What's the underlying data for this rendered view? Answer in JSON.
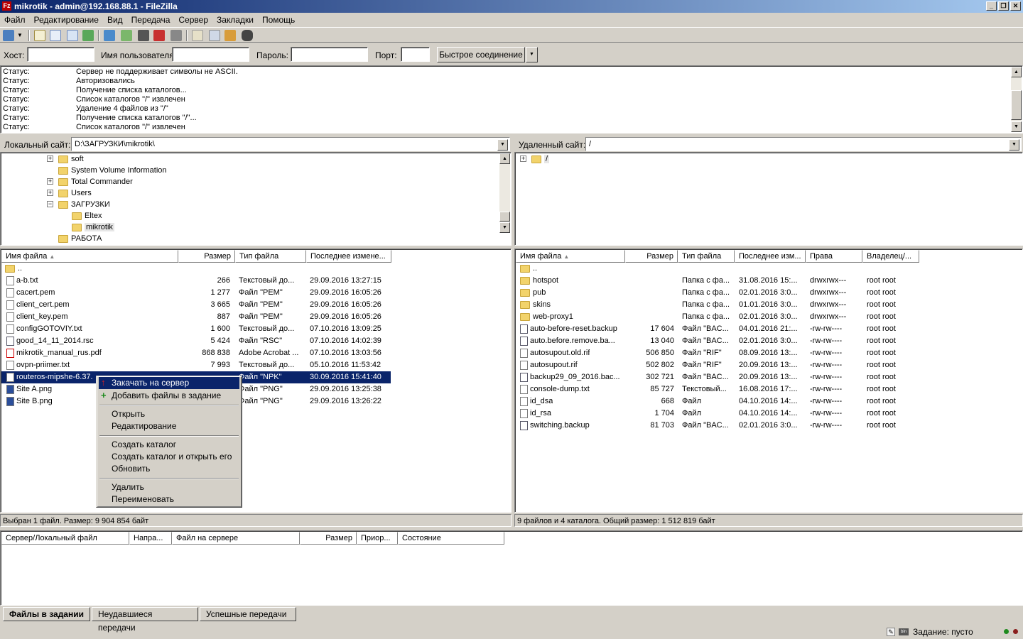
{
  "window": {
    "title": "mikrotik - admin@192.168.88.1 - FileZilla",
    "app_icon": "Fz"
  },
  "menu": [
    "Файл",
    "Редактирование",
    "Вид",
    "Передача",
    "Сервер",
    "Закладки",
    "Помощь"
  ],
  "quickconnect": {
    "host_label": "Хост:",
    "host_value": "",
    "user_label": "Имя пользователя",
    "user_value": "",
    "pass_label": "Пароль:",
    "pass_value": "",
    "port_label": "Порт:",
    "port_value": "",
    "connect_label": "Быстрое соединение"
  },
  "log": [
    {
      "label": "Статус:",
      "text": "Сервер не поддерживает символы не ASCII."
    },
    {
      "label": "Статус:",
      "text": "Авторизовались"
    },
    {
      "label": "Статус:",
      "text": "Получение списка каталогов..."
    },
    {
      "label": "Статус:",
      "text": "Список каталогов \"/\" извлечен"
    },
    {
      "label": "Статус:",
      "text": "Удаление 4 файлов из \"/\""
    },
    {
      "label": "Статус:",
      "text": "Получение списка каталогов \"/\"..."
    },
    {
      "label": "Статус:",
      "text": "Список каталогов \"/\" извлечен"
    }
  ],
  "local": {
    "site_label": "Локальный сайт:",
    "path": "D:\\ЗАГРУЗКИ\\mikrotik\\",
    "tree": [
      {
        "name": "soft",
        "expander": "+"
      },
      {
        "name": "System Volume Information",
        "expander": ""
      },
      {
        "name": "Total Commander",
        "expander": "+"
      },
      {
        "name": "Users",
        "expander": "+"
      },
      {
        "name": "ЗАГРУЗКИ",
        "expander": "−"
      },
      {
        "name": "Eltex",
        "expander": ""
      },
      {
        "name": "mikrotik",
        "expander": ""
      },
      {
        "name": "РАБОТА",
        "expander": ""
      }
    ],
    "columns": [
      "Имя файла",
      "Размер",
      "Тип файла",
      "Последнее измене..."
    ],
    "files": [
      {
        "name": "..",
        "size": "",
        "type": "",
        "modified": "",
        "icon": "folder"
      },
      {
        "name": "a-b.txt",
        "size": "266",
        "type": "Текстовый до...",
        "modified": "29.09.2016 13:27:15",
        "icon": "file"
      },
      {
        "name": "cacert.pem",
        "size": "1 277",
        "type": "Файл \"PEM\"",
        "modified": "29.09.2016 16:05:26",
        "icon": "file"
      },
      {
        "name": "client_cert.pem",
        "size": "3 665",
        "type": "Файл \"PEM\"",
        "modified": "29.09.2016 16:05:26",
        "icon": "file"
      },
      {
        "name": "client_key.pem",
        "size": "887",
        "type": "Файл \"PEM\"",
        "modified": "29.09.2016 16:05:26",
        "icon": "file"
      },
      {
        "name": "configGOTOVIY.txt",
        "size": "1 600",
        "type": "Текстовый до...",
        "modified": "07.10.2016 13:09:25",
        "icon": "file"
      },
      {
        "name": "good_14_11_2014.rsc",
        "size": "5 424",
        "type": "Файл \"RSC\"",
        "modified": "07.10.2016 14:02:39",
        "icon": "rsc"
      },
      {
        "name": "mikrotik_manual_rus.pdf",
        "size": "868 838",
        "type": "Adobe Acrobat ...",
        "modified": "07.10.2016 13:03:56",
        "icon": "pdf"
      },
      {
        "name": "ovpn-priimer.txt",
        "size": "7 993",
        "type": "Текстовый до...",
        "modified": "05.10.2016 11:53:42",
        "icon": "file"
      },
      {
        "name": "routeros-mipshe-6.37.",
        "size": "",
        "type": "Файл \"NPK\"",
        "modified": "30.09.2016 15:41:40",
        "icon": "file",
        "selected": true
      },
      {
        "name": "Site A.png",
        "size": "",
        "type": "Файл \"PNG\"",
        "modified": "29.09.2016 13:25:38",
        "icon": "png"
      },
      {
        "name": "Site B.png",
        "size": "",
        "type": "Файл \"PNG\"",
        "modified": "29.09.2016 13:26:22",
        "icon": "png"
      }
    ],
    "status": "Выбран 1 файл. Размер: 9 904 854 байт"
  },
  "remote": {
    "site_label": "Удаленный сайт:",
    "path": "/",
    "tree_root": "/",
    "columns": [
      "Имя файла",
      "Размер",
      "Тип файла",
      "Последнее изм...",
      "Права",
      "Владелец/..."
    ],
    "files": [
      {
        "name": "..",
        "size": "",
        "type": "",
        "modified": "",
        "perms": "",
        "owner": "",
        "icon": "folder"
      },
      {
        "name": "hotspot",
        "size": "",
        "type": "Папка с фа...",
        "modified": "31.08.2016 15:...",
        "perms": "drwxrwx---",
        "owner": "root root",
        "icon": "folder"
      },
      {
        "name": "pub",
        "size": "",
        "type": "Папка с фа...",
        "modified": "02.01.2016 3:0...",
        "perms": "drwxrwx---",
        "owner": "root root",
        "icon": "folder"
      },
      {
        "name": "skins",
        "size": "",
        "type": "Папка с фа...",
        "modified": "01.01.2016 3:0...",
        "perms": "drwxrwx---",
        "owner": "root root",
        "icon": "folder"
      },
      {
        "name": "web-proxy1",
        "size": "",
        "type": "Папка с фа...",
        "modified": "02.01.2016 3:0...",
        "perms": "drwxrwx---",
        "owner": "root root",
        "icon": "folder"
      },
      {
        "name": "auto-before-reset.backup",
        "size": "17 604",
        "type": "Файл \"BAC...",
        "modified": "04.01.2016 21:...",
        "perms": "-rw-rw----",
        "owner": "root root",
        "icon": "rsc"
      },
      {
        "name": "auto.before.remove.ba...",
        "size": "13 040",
        "type": "Файл \"BAC...",
        "modified": "02.01.2016 3:0...",
        "perms": "-rw-rw----",
        "owner": "root root",
        "icon": "rsc"
      },
      {
        "name": "autosupout.old.rif",
        "size": "506 850",
        "type": "Файл \"RIF\"",
        "modified": "08.09.2016 13:...",
        "perms": "-rw-rw----",
        "owner": "root root",
        "icon": "file"
      },
      {
        "name": "autosupout.rif",
        "size": "502 802",
        "type": "Файл \"RIF\"",
        "modified": "20.09.2016 13:...",
        "perms": "-rw-rw----",
        "owner": "root root",
        "icon": "file"
      },
      {
        "name": "backup29_09_2016.bac...",
        "size": "302 721",
        "type": "Файл \"BAC...",
        "modified": "20.09.2016 13:...",
        "perms": "-rw-rw----",
        "owner": "root root",
        "icon": "rsc"
      },
      {
        "name": "console-dump.txt",
        "size": "85 727",
        "type": "Текстовый...",
        "modified": "16.08.2016 17:...",
        "perms": "-rw-rw----",
        "owner": "root root",
        "icon": "file"
      },
      {
        "name": "id_dsa",
        "size": "668",
        "type": "Файл",
        "modified": "04.10.2016 14:...",
        "perms": "-rw-rw----",
        "owner": "root root",
        "icon": "file"
      },
      {
        "name": "id_rsa",
        "size": "1 704",
        "type": "Файл",
        "modified": "04.10.2016 14:...",
        "perms": "-rw-rw----",
        "owner": "root root",
        "icon": "file"
      },
      {
        "name": "switching.backup",
        "size": "81 703",
        "type": "Файл \"BAC...",
        "modified": "02.01.2016 3:0...",
        "perms": "-rw-rw----",
        "owner": "root root",
        "icon": "rsc"
      }
    ],
    "status": "9 файлов и 4 каталога. Общий размер: 1 512 819 байт"
  },
  "context_menu": {
    "items": [
      {
        "label": "Закачать на сервер",
        "highlighted": true,
        "icon": "upload-arrow-icon"
      },
      {
        "label": "Добавить файлы в задание",
        "icon": "add-to-queue-icon"
      },
      {
        "sep": true
      },
      {
        "label": "Открыть"
      },
      {
        "label": "Редактирование"
      },
      {
        "sep": true
      },
      {
        "label": "Создать каталог"
      },
      {
        "label": "Создать каталог и открыть его"
      },
      {
        "label": "Обновить"
      },
      {
        "sep": true
      },
      {
        "label": "Удалить"
      },
      {
        "label": "Переименовать"
      }
    ]
  },
  "queue": {
    "columns": [
      "Сервер/Локальный файл",
      "Напра...",
      "Файл на сервере",
      "Размер",
      "Приор...",
      "Состояние"
    ],
    "tabs": [
      "Файлы в задании",
      "Неудавшиеся передачи",
      "Успешные передачи"
    ]
  },
  "statusbar": {
    "queue_text": "Задание: пусто"
  },
  "colors": {
    "selection": "#0a246a",
    "face": "#d4d0c8",
    "folder": "#f2d36b"
  }
}
